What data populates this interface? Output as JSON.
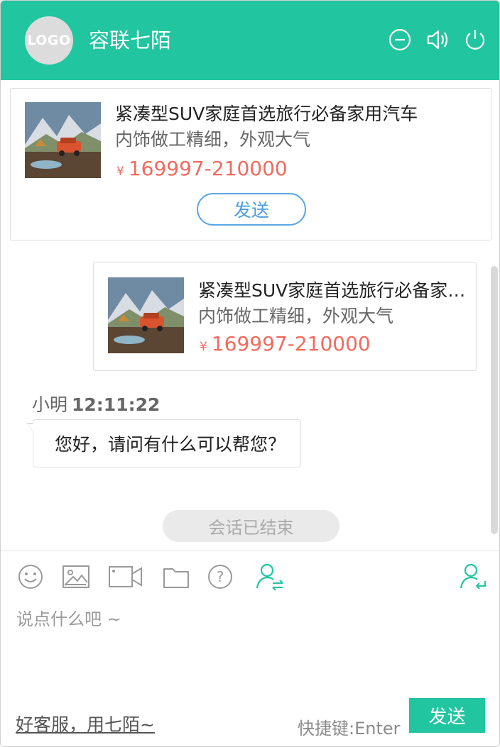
{
  "header": {
    "logo_text": "LOGO",
    "title": "容联七陌",
    "icons": [
      "minimize-icon",
      "speaker-icon",
      "power-icon"
    ],
    "bg_color": "#21c5a0"
  },
  "product_card": {
    "title": "紧凑型SUV家庭首选旅行必备家用汽车",
    "subtitle": "内饰做工精细，外观大气",
    "currency": "¥",
    "price": "169997-210000",
    "send_label": "发送"
  },
  "sent_card": {
    "title": "紧凑型SUV家庭首选旅行必备家用汽车",
    "subtitle": "内饰做工精细，外观大气",
    "currency": "¥",
    "price": "169997-210000"
  },
  "message": {
    "sender": "小明",
    "time": "12:11:22",
    "text": "您好，请问有什么可以帮您？"
  },
  "status": {
    "ended_text": "会话已结束"
  },
  "toolbar": {
    "icons": [
      "emoji-icon",
      "image-icon",
      "video-icon",
      "folder-icon",
      "help-icon",
      "transfer-agent-icon",
      "return-agent-icon"
    ]
  },
  "input": {
    "placeholder": "说点什么吧 ~"
  },
  "footer": {
    "link_text": "好客服，用七陌~",
    "shortcut_text": "快捷键:Enter",
    "send_label": "发送"
  },
  "colors": {
    "accent": "#21c5a0",
    "price": "#f26a5e",
    "pill_border": "#5aa6e6"
  }
}
